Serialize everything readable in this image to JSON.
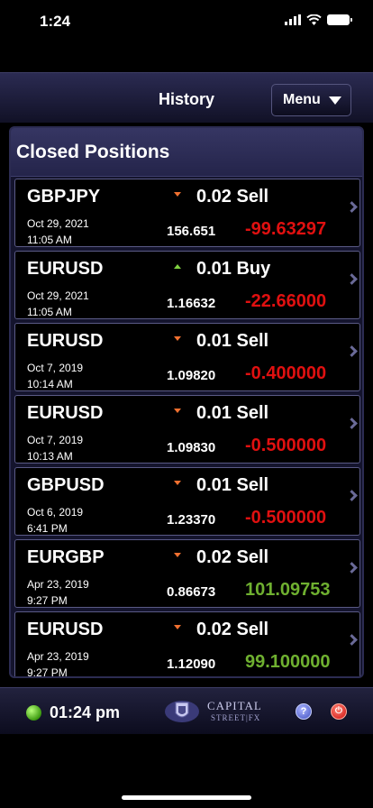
{
  "status_bar": {
    "time": "1:24"
  },
  "nav": {
    "title": "History",
    "menu_label": "Menu"
  },
  "panel": {
    "title": "Closed Positions"
  },
  "positions": [
    {
      "symbol": "GBPJPY",
      "direction": "down",
      "trade": "0.02 Sell",
      "date": "Oct 29, 2021",
      "time": "11:05 AM",
      "price": "156.651",
      "pl": "-99.63297",
      "pl_color": "#e01010"
    },
    {
      "symbol": "EURUSD",
      "direction": "up",
      "trade": "0.01 Buy",
      "date": "Oct 29, 2021",
      "time": "11:05 AM",
      "price": "1.16632",
      "pl": "-22.66000",
      "pl_color": "#e01010"
    },
    {
      "symbol": "EURUSD",
      "direction": "down",
      "trade": "0.01 Sell",
      "date": "Oct 7, 2019",
      "time": "10:14 AM",
      "price": "1.09820",
      "pl": "-0.400000",
      "pl_color": "#e01010"
    },
    {
      "symbol": "EURUSD",
      "direction": "down",
      "trade": "0.01 Sell",
      "date": "Oct 7, 2019",
      "time": "10:13 AM",
      "price": "1.09830",
      "pl": "-0.500000",
      "pl_color": "#e01010"
    },
    {
      "symbol": "GBPUSD",
      "direction": "down",
      "trade": "0.01 Sell",
      "date": "Oct 6, 2019",
      "time": "6:41 PM",
      "price": "1.23370",
      "pl": "-0.500000",
      "pl_color": "#e01010"
    },
    {
      "symbol": "EURGBP",
      "direction": "down",
      "trade": "0.02 Sell",
      "date": "Apr 23, 2019",
      "time": "9:27 PM",
      "price": "0.86673",
      "pl": "101.09753",
      "pl_color": "#6fb030"
    },
    {
      "symbol": "EURUSD",
      "direction": "down",
      "trade": "0.02 Sell",
      "date": "Apr 23, 2019",
      "time": "9:27 PM",
      "price": "1.12090",
      "pl": "99.100000",
      "pl_color": "#6fb030"
    }
  ],
  "footer": {
    "clock": "01:24 pm",
    "logo_line1": "CAPITAL",
    "logo_line2": "STREET|FX",
    "help_glyph": "?",
    "power_glyph": "⏻",
    "connection_color": "#3c9a10"
  }
}
